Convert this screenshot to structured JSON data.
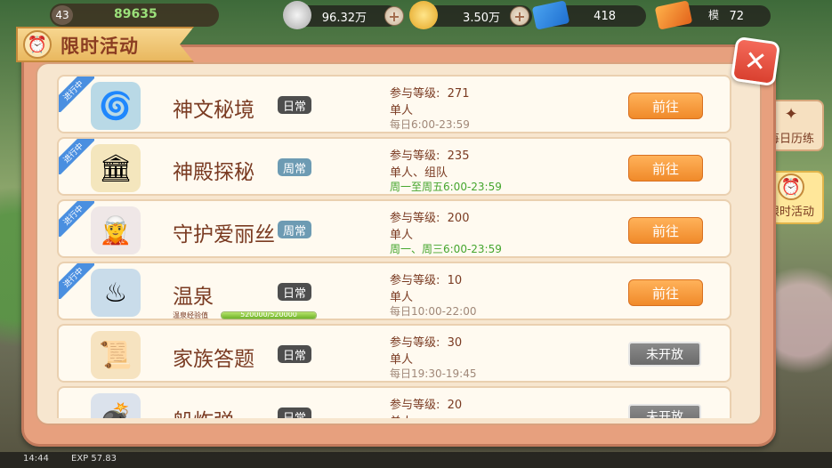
{
  "top": {
    "level": "43",
    "power": "89635",
    "silver": "96.32万",
    "gold": "3.50万",
    "ticket_blue": "418",
    "ticket_orange": "72",
    "bg_text": "模"
  },
  "side_tabs": [
    {
      "label": "每日历练"
    },
    {
      "label": "限时活动"
    }
  ],
  "title": "限时活动",
  "close_symbol": "✕",
  "in_progress_tag": "进行中",
  "level_prefix": "参与等级:",
  "activities": [
    {
      "name": "神文秘境",
      "badge": "日常",
      "level": "271",
      "mode": "单人",
      "time": "每日6:00-23:59",
      "time_color": "#a08878",
      "button": "前往",
      "open": true,
      "in_progress": true,
      "icon": "🌀",
      "thumb_bg": "#b9d9e6"
    },
    {
      "name": "神殿探秘",
      "badge": "周常",
      "level": "235",
      "mode": "单人、组队",
      "time": "周一至周五6:00-23:59",
      "time_color": "#45a62e",
      "button": "前往",
      "open": true,
      "in_progress": true,
      "icon": "🏛",
      "thumb_bg": "#f4e6bd"
    },
    {
      "name": "守护爱丽丝",
      "badge": "周常",
      "level": "200",
      "mode": "单人",
      "time": "周一、周三6:00-23:59",
      "time_color": "#45a62e",
      "button": "前往",
      "open": true,
      "in_progress": true,
      "icon": "🧝",
      "thumb_bg": "#efe7e7"
    },
    {
      "name": "温泉",
      "badge": "日常",
      "level": "10",
      "mode": "单人",
      "time": "每日10:00-22:00",
      "time_color": "#a08878",
      "button": "前往",
      "open": true,
      "in_progress": true,
      "icon": "♨",
      "thumb_bg": "#c9dcea",
      "exp_label": "温泉经验值",
      "exp_text": "520000/520000",
      "exp_fraction": 1.0
    },
    {
      "name": "家族答题",
      "badge": "日常",
      "level": "30",
      "mode": "单人",
      "time": "每日19:30-19:45",
      "time_color": "#a08878",
      "button": "未开放",
      "open": false,
      "in_progress": false,
      "icon": "📜",
      "thumb_bg": "#f6e3c0"
    },
    {
      "name": "船炸弹",
      "badge": "日常",
      "level": "20",
      "mode": "单人",
      "time": "",
      "time_color": "#a08878",
      "button": "未开放",
      "open": false,
      "in_progress": false,
      "icon": "💣",
      "thumb_bg": "#dbe2ec"
    }
  ],
  "status": {
    "clock": "14:44",
    "exp": "EXP 57.83"
  },
  "colors": {
    "badge_daily": "#4e4e4e",
    "badge_weekly": "#6d9bb3",
    "accent": "#f08a2a"
  }
}
